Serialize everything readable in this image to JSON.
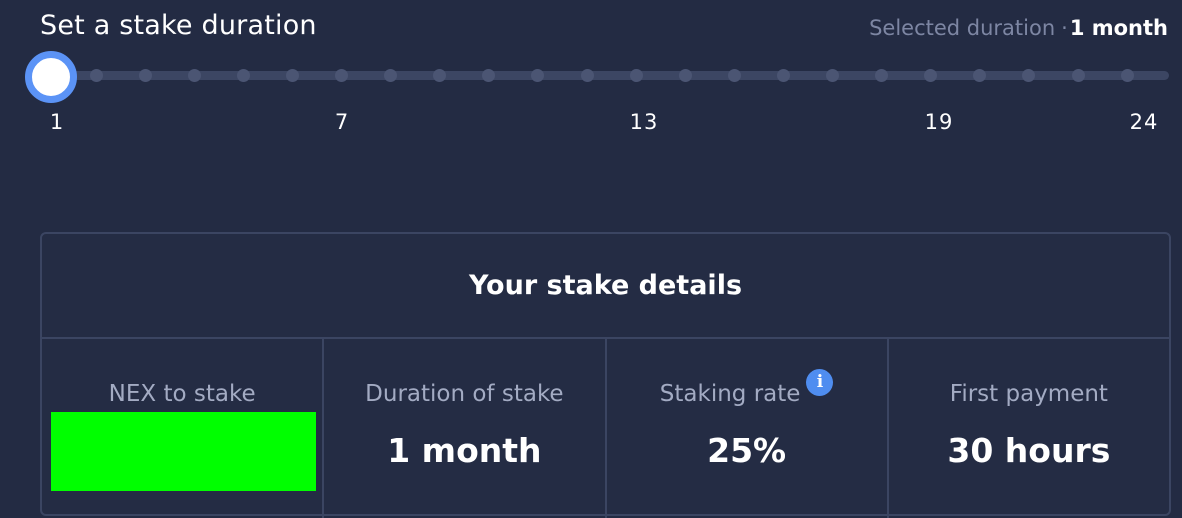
{
  "header": {
    "title": "Set a stake duration",
    "selected_label": "Selected duration",
    "selected_separator": "·",
    "selected_value": "1 month"
  },
  "slider": {
    "min": 1,
    "max": 24,
    "value": 1,
    "tick_labels": [
      "1",
      "7",
      "13",
      "19",
      "24"
    ],
    "colors": {
      "track": "#3c4663",
      "thumb_border": "#5b93f6",
      "thumb_fill": "#ffffff"
    }
  },
  "details": {
    "title": "Your stake details",
    "nex_label": "NEX to stake",
    "duration_label": "Duration of stake",
    "duration_value": "1 month",
    "rate_label": "Staking rate",
    "rate_info_icon": "info-icon",
    "rate_value": "25%",
    "payment_label": "First payment",
    "payment_value": "30 hours"
  },
  "colors": {
    "background": "#232b43",
    "border": "#3b4562",
    "accent": "#5b93f6",
    "input_fill": "#00ff00"
  }
}
